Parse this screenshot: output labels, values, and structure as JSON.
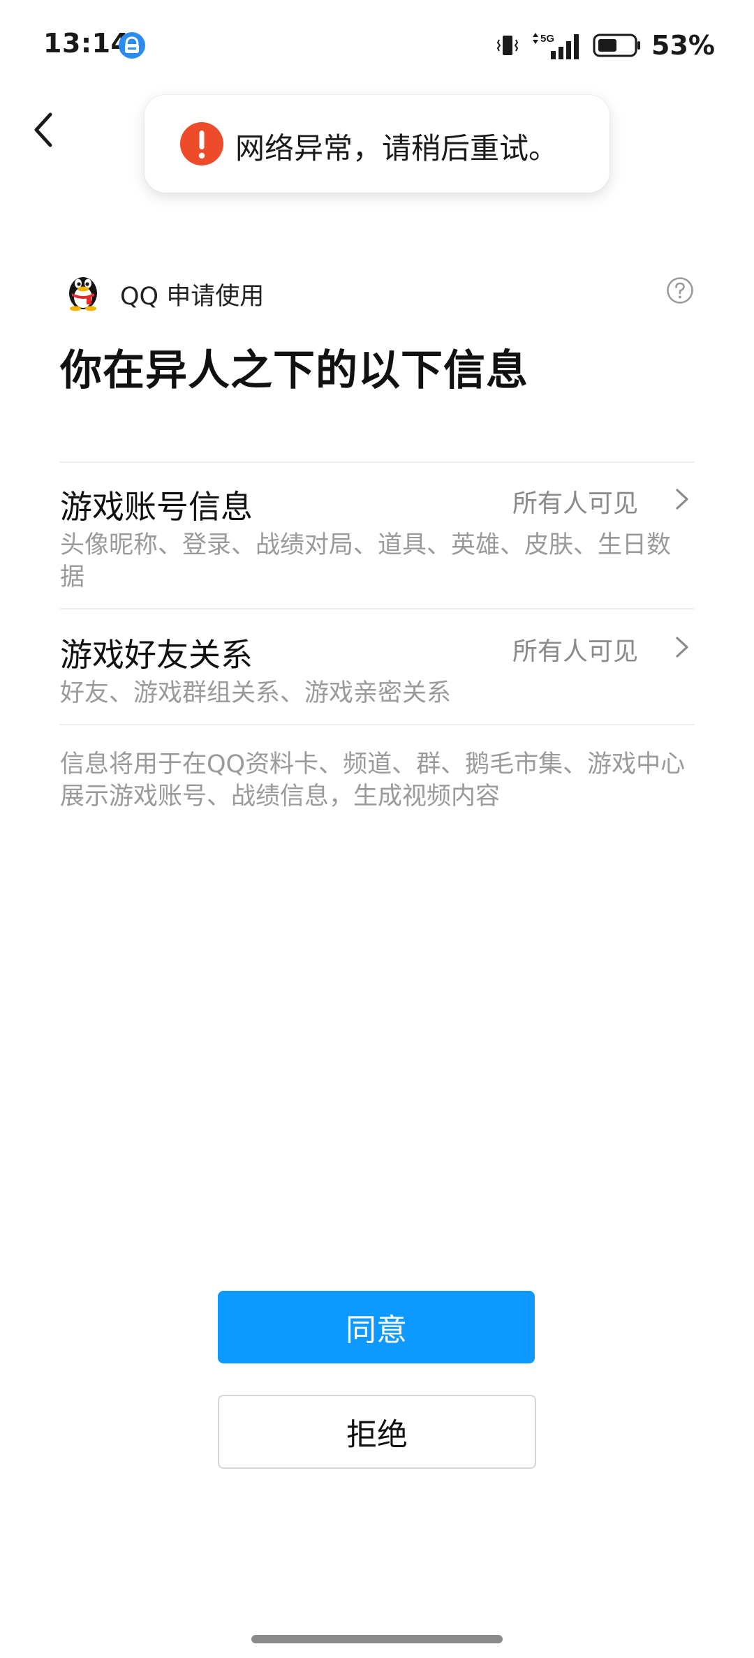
{
  "status_bar": {
    "time": "13:14",
    "battery_text": "53%",
    "network": "5G"
  },
  "toast": {
    "message": "网络异常，请稍后重试。",
    "icon": "error-icon",
    "icon_color": "#ee4b2b"
  },
  "header": {
    "back_icon": "chevron-left-icon"
  },
  "app_request": {
    "app_name_text": "QQ 申请使用",
    "avatar_icon": "qq-penguin-icon",
    "help_icon": "question-circle-icon"
  },
  "title": "你在异人之下的以下信息",
  "permissions": [
    {
      "title": "游戏账号信息",
      "visibility": "所有人可见",
      "description": "头像昵称、登录、战绩对局、道具、英雄、皮肤、生日数据"
    },
    {
      "title": "游戏好友关系",
      "visibility": "所有人可见",
      "description": "好友、游戏群组关系、游戏亲密关系"
    }
  ],
  "footnote": "信息将用于在QQ资料卡、频道、群、鹅毛市集、游戏中心展示游戏账号、战绩信息，生成视频内容",
  "actions": {
    "agree_label": "同意",
    "reject_label": "拒绝"
  },
  "colors": {
    "primary": "#0d99ff",
    "error": "#ee4b2b",
    "secondary_text": "#9a9a9a"
  }
}
